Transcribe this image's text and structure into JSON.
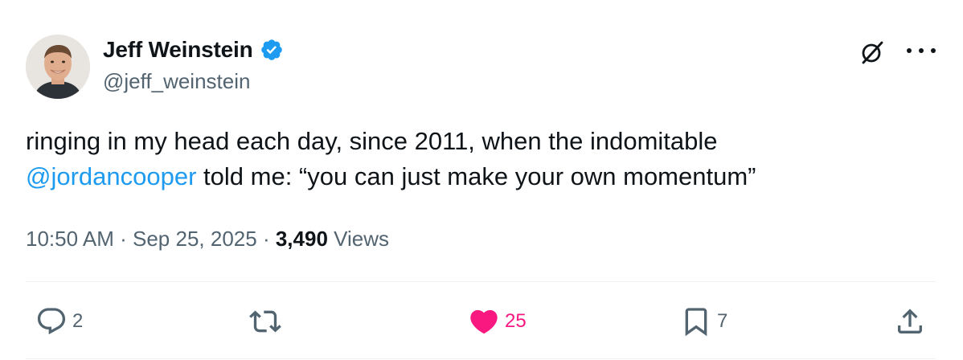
{
  "author": {
    "display_name": "Jeff Weinstein",
    "handle": "@jeff_weinstein",
    "verified": true
  },
  "tweet": {
    "text_before": "ringing in my head each day, since 2011, when the indomitable ",
    "mention": "@jordancooper",
    "text_after": " told me: “you can just make your own momentum”"
  },
  "meta": {
    "time": "10:50 AM",
    "separator": "·",
    "date": "Sep 25, 2025",
    "views_count": "3,490",
    "views_label": "Views"
  },
  "actions": {
    "replies": "2",
    "retweets": "",
    "likes": "25",
    "bookmarks": "7"
  },
  "icons": {
    "top_right": [
      "grok-icon",
      "more-icon"
    ],
    "actions": [
      "reply-icon",
      "retweet-icon",
      "like-icon",
      "bookmark-icon",
      "share-icon"
    ]
  },
  "colors": {
    "text": "#0f1419",
    "secondary": "#536471",
    "link": "#1d9bf0",
    "like": "#f91880",
    "verified": "#1d9bf0"
  }
}
